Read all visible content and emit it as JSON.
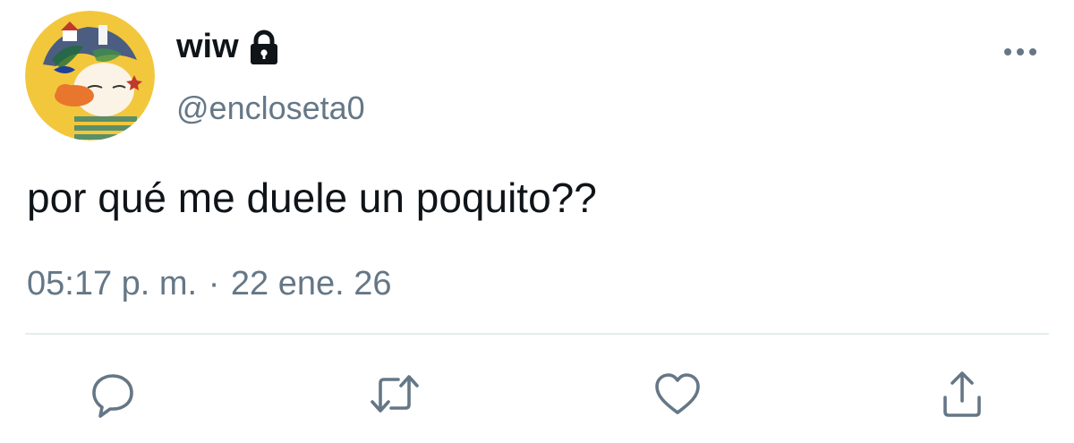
{
  "user": {
    "display_name": "wiw",
    "handle": "@encloseta0",
    "protected_icon": "lock-icon",
    "avatar_icon": "avatar-illustration"
  },
  "tweet": {
    "text": "por qué me duele un poquito??",
    "time": "05:17 p. m.",
    "separator": "·",
    "date": "22 ene. 26"
  },
  "menu": {
    "icon": "more-horizontal-icon"
  },
  "actions": [
    {
      "name": "reply",
      "icon": "speech-bubble-icon"
    },
    {
      "name": "retweet",
      "icon": "retweet-arrows-icon"
    },
    {
      "name": "like",
      "icon": "heart-icon"
    },
    {
      "name": "share",
      "icon": "share-upload-icon"
    }
  ],
  "colors": {
    "text_primary": "#0f1419",
    "text_secondary": "#657786",
    "divider": "#e6ecf0",
    "icon": "#657786"
  }
}
